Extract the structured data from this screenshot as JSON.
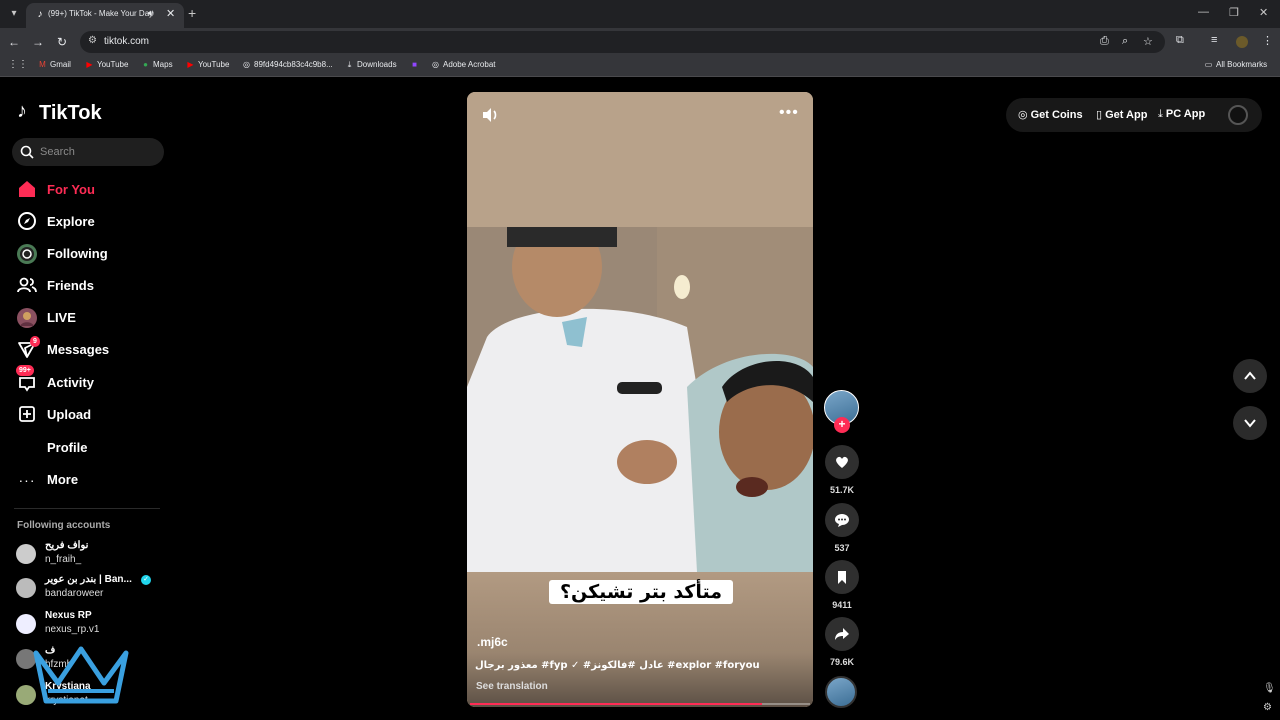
{
  "browser": {
    "tab_title": "(99+) TikTok - Make Your Day",
    "url": "tiktok.com",
    "bookmarks": [
      {
        "label": "Gmail",
        "icon": "gmail-icon"
      },
      {
        "label": "YouTube",
        "icon": "youtube-icon"
      },
      {
        "label": "Maps",
        "icon": "maps-icon"
      },
      {
        "label": "YouTube",
        "icon": "youtube-icon"
      },
      {
        "label": "89fd494cb83c4c9b8...",
        "icon": "globe-icon"
      },
      {
        "label": "Downloads",
        "icon": "download-icon"
      },
      {
        "label": "",
        "icon": "twitch-icon"
      },
      {
        "label": "Adobe Acrobat",
        "icon": "globe-icon"
      }
    ],
    "all_bookmarks": "All Bookmarks"
  },
  "tiktok": {
    "logo": "TikTok",
    "search_placeholder": "Search",
    "nav": [
      {
        "label": "For You",
        "icon": "home-icon",
        "active": true
      },
      {
        "label": "Explore",
        "icon": "compass-icon"
      },
      {
        "label": "Following",
        "icon": "following-icon"
      },
      {
        "label": "Friends",
        "icon": "friends-icon"
      },
      {
        "label": "LIVE",
        "icon": "live-icon"
      },
      {
        "label": "Messages",
        "icon": "messages-icon",
        "badge": "9"
      },
      {
        "label": "Activity",
        "icon": "activity-icon",
        "badge": "99+"
      },
      {
        "label": "Upload",
        "icon": "upload-icon"
      },
      {
        "label": "Profile",
        "icon": ""
      },
      {
        "label": "More",
        "icon": "more-icon"
      }
    ],
    "following_title": "Following accounts",
    "accounts": [
      {
        "name": "نواف فريح",
        "handle": "n_fraih_"
      },
      {
        "name": "بندر بن عوير | Ban...",
        "handle": "bandaroweer",
        "verified": true
      },
      {
        "name": "Nexus RP",
        "handle": "nexus_rp.v1"
      },
      {
        "name": "ف",
        "handle": "hfzmh"
      },
      {
        "name": "Krystiana",
        "handle": "krystianat..."
      }
    ]
  },
  "video": {
    "caption": "متأكد بتر تشيكن؟",
    "author": ".mj6c",
    "description": "معذور برجال #fyp ✓ #عادل #فالكونز #explor #foryou",
    "see_translation": "See translation",
    "progress": 0.86
  },
  "actions": {
    "likes": "51.7K",
    "comments": "537",
    "saves": "9411",
    "shares": "79.6K"
  },
  "topright": {
    "coins": "Get Coins",
    "app": "Get App",
    "pc_app": "PC App"
  }
}
